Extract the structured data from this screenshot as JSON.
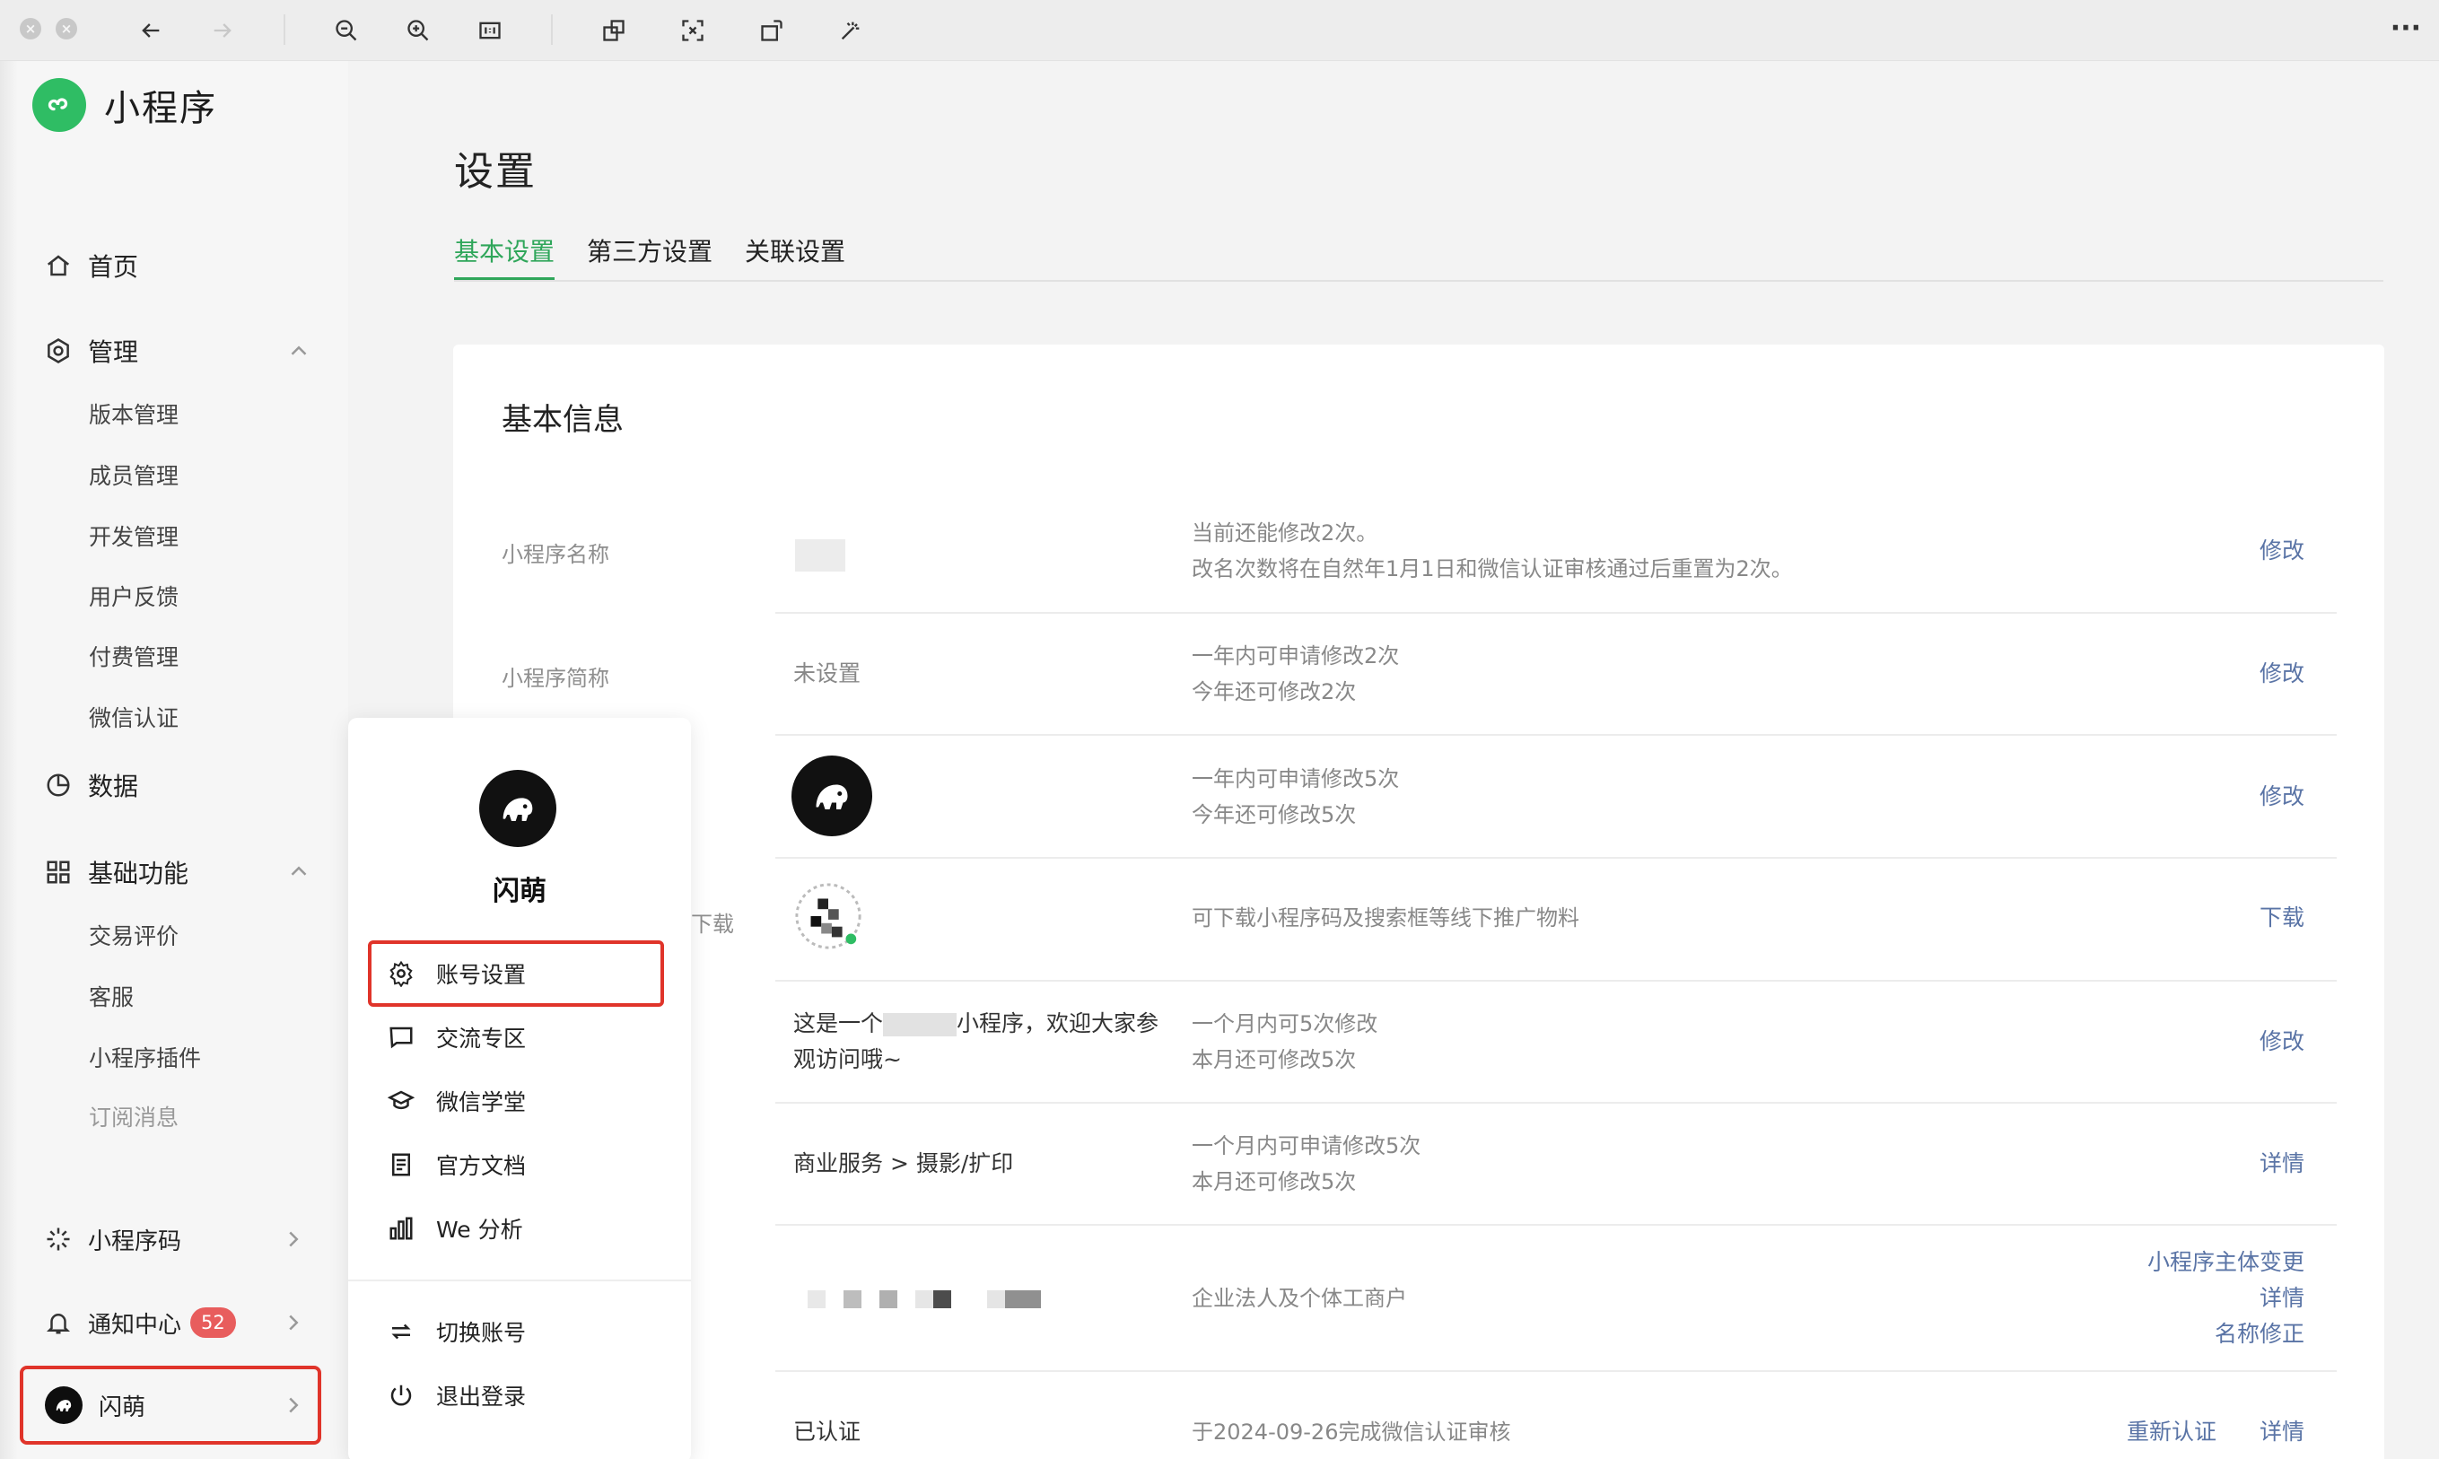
{
  "toolbar": {
    "more_label": "···"
  },
  "sidebar": {
    "brand": "小程序",
    "home": "首页",
    "manage": {
      "label": "管理",
      "items": [
        "版本管理",
        "成员管理",
        "开发管理",
        "用户反馈",
        "付费管理",
        "微信认证"
      ]
    },
    "data": "数据",
    "basic": {
      "label": "基础功能",
      "items": [
        "交易评价",
        "客服",
        "小程序插件",
        "订阅消息"
      ]
    },
    "qrcode": "小程序码",
    "notice": {
      "label": "通知中心",
      "badge": "52"
    },
    "account": "闪萌"
  },
  "main": {
    "title": "设置",
    "tabs": [
      "基本设置",
      "第三方设置",
      "关联设置"
    ],
    "section_title": "基本信息",
    "rows": [
      {
        "label": "小程序名称",
        "value": "",
        "note1": "当前还能修改2次。",
        "note2": "改名次数将在自然年1月1日和微信认证审核通过后重置为2次。",
        "action": "修改"
      },
      {
        "label": "小程序简称",
        "value": "未设置",
        "note1": "一年内可申请修改2次",
        "note2": "今年还可修改2次",
        "action": "修改"
      },
      {
        "label": "",
        "value": "",
        "note1": "一年内可申请修改5次",
        "note2": "今年还可修改5次",
        "action": "修改"
      },
      {
        "label": "料下载",
        "value": "",
        "note1": "可下载小程序码及搜索框等线下推广物料",
        "note2": "",
        "action": "下载"
      },
      {
        "label": "",
        "value1": "这是一个",
        "value1b": "小程序，欢迎大家参",
        "value2": "观访问哦~",
        "note1": "一个月内可5次修改",
        "note2": "本月还可修改5次",
        "action": "修改"
      },
      {
        "label": "",
        "value": "商业服务 > 摄影/扩印",
        "note1": "一个月内可申请修改5次",
        "note2": "本月还可修改5次",
        "action": "详情"
      },
      {
        "label": "",
        "value": "",
        "note1": "企业法人及个体工商户",
        "actions": [
          "小程序主体变更",
          "详情",
          "名称修正"
        ]
      },
      {
        "label": "",
        "value": "已认证",
        "note1": "于2024-09-26完成微信认证审核",
        "actions": [
          "重新认证",
          "详情"
        ]
      }
    ]
  },
  "popup": {
    "name": "闪萌",
    "items": [
      "账号设置",
      "交流专区",
      "微信学堂",
      "官方文档",
      "We 分析"
    ],
    "bottom_items": [
      "切换账号",
      "退出登录"
    ]
  },
  "colors": {
    "accent_green": "#2fa65a",
    "link_blue": "#5a74a6",
    "highlight_red": "#e0342a",
    "badge_red": "#e85d5d"
  }
}
